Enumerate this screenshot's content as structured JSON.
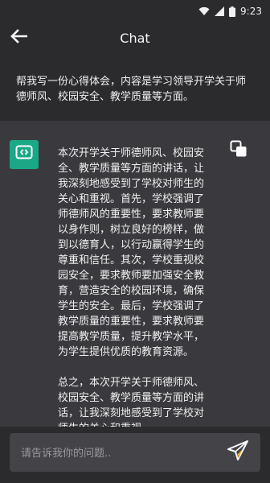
{
  "status_bar": {
    "time": "9:23",
    "icons": [
      "wifi-icon",
      "signal-icon",
      "battery-icon"
    ]
  },
  "app_bar": {
    "title": "Chat",
    "back_icon": "arrow-left-icon"
  },
  "user_message": "帮我写一份心得体会，内容是学习领导开学关于师德师风、校园安全、教学质量等方面。",
  "bot_message": {
    "avatar_icon": "chat-bot-icon",
    "copy_icon": "copy-icon",
    "paragraphs": [
      "本次开学关于师德师风、校园安全、教学质量等方面的讲话，让我深刻地感受到了学校对师生的关心和重视。首先，学校强调了师德师风的重要性，要求教师要以身作则，树立良好的榜样，做到以德育人，以行动赢得学生的尊重和信任。其次，学校重视校园安全，要求教师要加强安全教育，营造安全的校园环境，确保学生的安全。最后，学校强调了教学质量的重要性，要求教师要提高教学质量，提升教学水平，为学生提供优质的教育资源。",
      "总之，本次开学关于师德师风、校园安全、教学质量等方面的讲话，让我深刻地感受到了学校对师生的关心和重视"
    ]
  },
  "input": {
    "placeholder": "请告诉我你的问题..",
    "value": "",
    "send_icon": "send-icon"
  },
  "colors": {
    "background": "#2b2b2e",
    "bot_panel": "#3a3a3e",
    "input_box": "#444448",
    "avatar_green": "#1aa886",
    "send_accent": "#f0b429"
  }
}
